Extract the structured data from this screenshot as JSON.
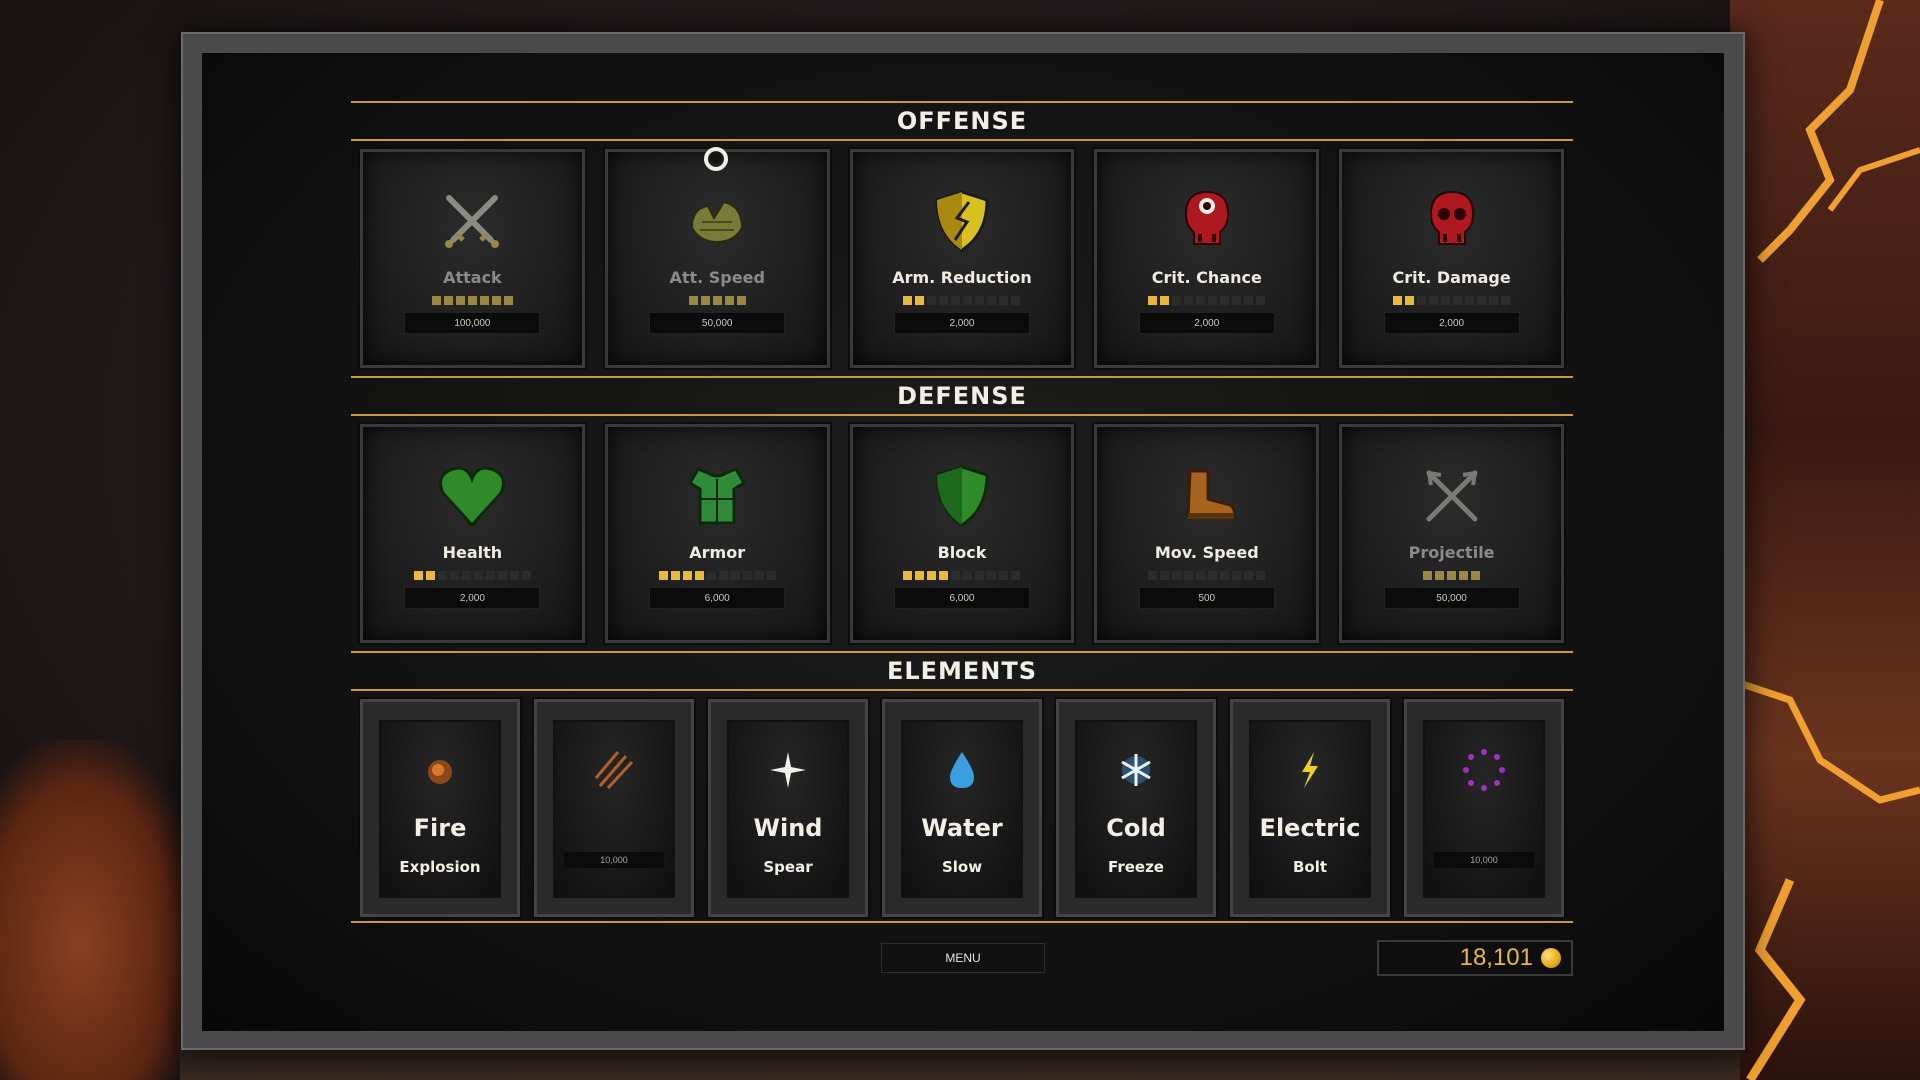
{
  "sections": {
    "offense": "OFFENSE",
    "defense": "DEFENSE",
    "elements": "ELEMENTS"
  },
  "offense": [
    {
      "label": "Attack",
      "cost": "100,000",
      "level": 7,
      "max": 7,
      "icon": "crossed-swords-icon",
      "maxed": true
    },
    {
      "label": "Att. Speed",
      "cost": "50,000",
      "level": 5,
      "max": 5,
      "icon": "gloves-icon",
      "maxed": true
    },
    {
      "label": "Arm. Reduction",
      "cost": "2,000",
      "level": 2,
      "max": 10,
      "icon": "cracked-shield-icon",
      "maxed": false
    },
    {
      "label": "Crit. Chance",
      "cost": "2,000",
      "level": 2,
      "max": 10,
      "icon": "target-skull-icon",
      "maxed": false
    },
    {
      "label": "Crit. Damage",
      "cost": "2,000",
      "level": 2,
      "max": 10,
      "icon": "red-skull-icon",
      "maxed": false
    }
  ],
  "defense": [
    {
      "label": "Health",
      "cost": "2,000",
      "level": 2,
      "max": 10,
      "icon": "heart-icon",
      "maxed": false
    },
    {
      "label": "Armor",
      "cost": "6,000",
      "level": 4,
      "max": 10,
      "icon": "armor-vest-icon",
      "maxed": false
    },
    {
      "label": "Block",
      "cost": "6,000",
      "level": 4,
      "max": 10,
      "icon": "shield-icon",
      "maxed": false
    },
    {
      "label": "Mov. Speed",
      "cost": "500",
      "level": 0,
      "max": 10,
      "icon": "boot-icon",
      "maxed": false
    },
    {
      "label": "Projectile",
      "cost": "50,000",
      "level": 5,
      "max": 5,
      "icon": "crossed-arrows-icon",
      "maxed": true
    }
  ],
  "elements": [
    {
      "name": "Fire",
      "sub": "Explosion",
      "icon": "fire-icon",
      "cost": ""
    },
    {
      "name": "",
      "sub": "",
      "icon": "claw-slash-icon",
      "cost": "10,000"
    },
    {
      "name": "Wind",
      "sub": "Spear",
      "icon": "wind-star-icon",
      "cost": ""
    },
    {
      "name": "Water",
      "sub": "Slow",
      "icon": "water-drop-icon",
      "cost": ""
    },
    {
      "name": "Cold",
      "sub": "Freeze",
      "icon": "snowflake-icon",
      "cost": ""
    },
    {
      "name": "Electric",
      "sub": "Bolt",
      "icon": "lightning-icon",
      "cost": ""
    },
    {
      "name": "",
      "sub": "",
      "icon": "purple-ring-icon",
      "cost": "10,000"
    }
  ],
  "footer": {
    "menu_label": "MENU",
    "gold": "18,101"
  },
  "colors": {
    "accent_gold": "#c49a45",
    "pip_on": "#e8b93c",
    "coin": "#e8a916"
  }
}
